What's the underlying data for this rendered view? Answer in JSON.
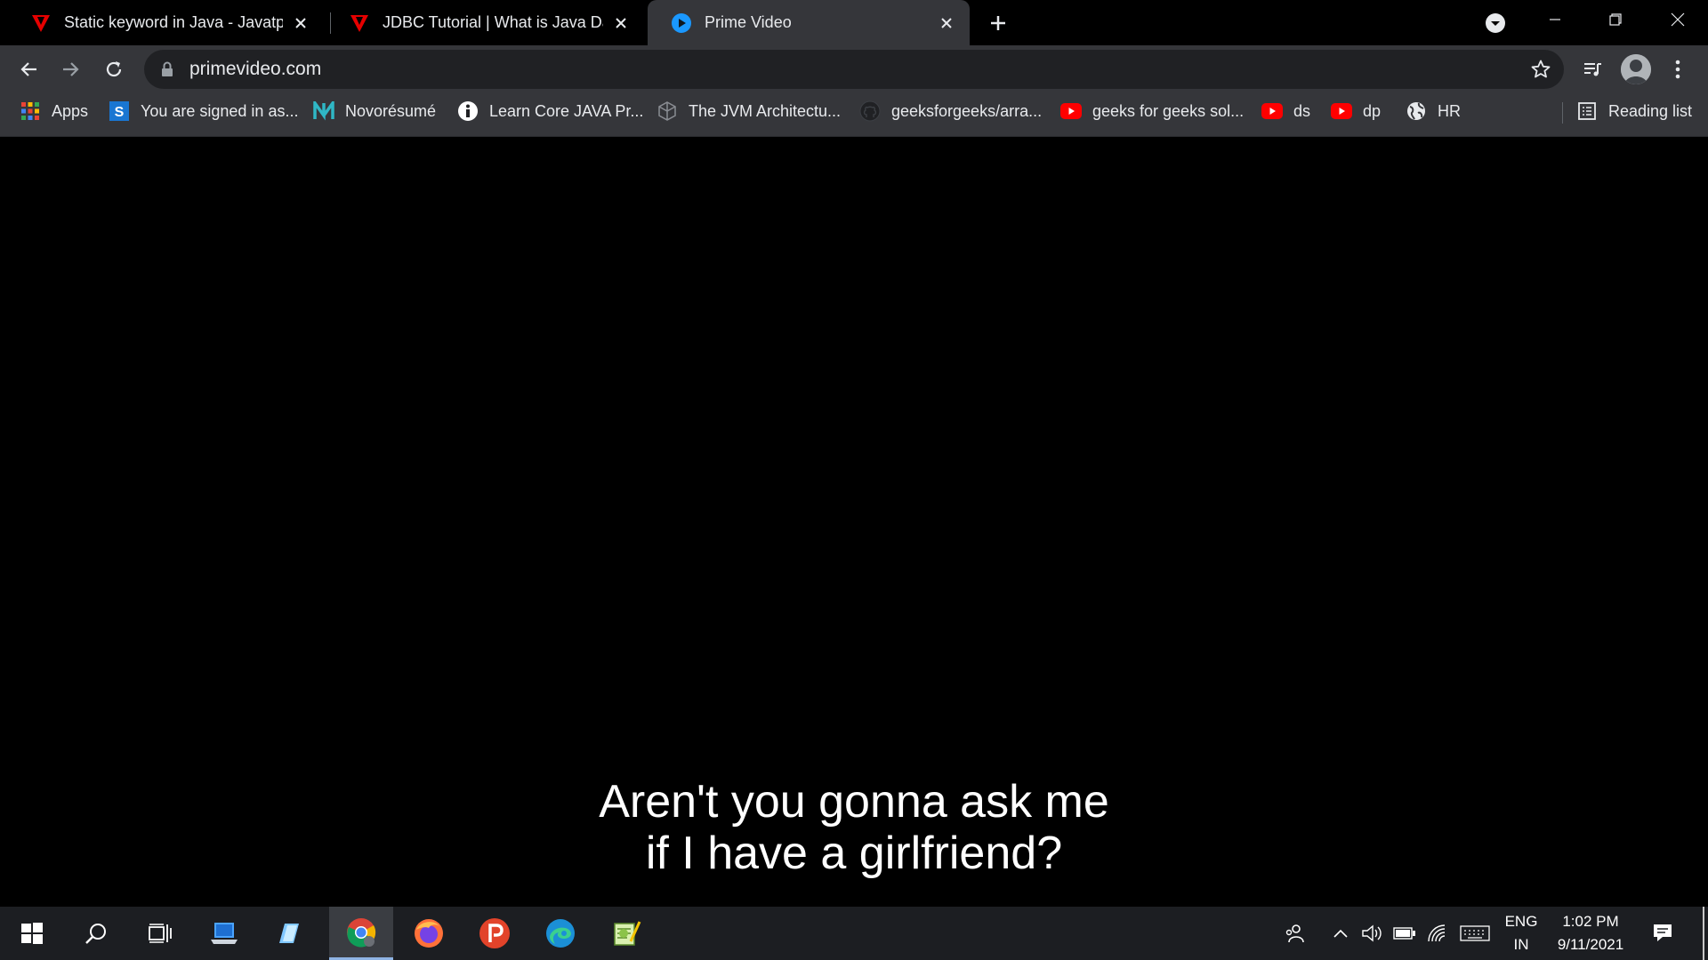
{
  "browser": {
    "tabs": [
      {
        "title": "Static keyword in Java - Javatpoint",
        "favicon": "javatpoint-favicon",
        "active": false
      },
      {
        "title": "JDBC Tutorial | What is Java Database Connectivity",
        "favicon": "javatpoint-favicon",
        "active": false
      },
      {
        "title": "Prime Video",
        "favicon": "primevideo-favicon",
        "active": true
      }
    ],
    "url": "primevideo.com",
    "bookmarks": [
      {
        "label": "Apps",
        "icon": "apps-grid-icon"
      },
      {
        "label": "You are signed in as...",
        "icon": "s-icon"
      },
      {
        "label": "Novorésumé",
        "icon": "novoresume-icon"
      },
      {
        "label": "Learn Core JAVA Pr...",
        "icon": "info-icon"
      },
      {
        "label": "The JVM Architectu...",
        "icon": "cube-icon"
      },
      {
        "label": "geeksforgeeks/arra...",
        "icon": "github-icon"
      },
      {
        "label": "geeks for geeks sol...",
        "icon": "youtube-icon"
      },
      {
        "label": "ds",
        "icon": "youtube-icon"
      },
      {
        "label": "dp",
        "icon": "youtube-icon"
      },
      {
        "label": "HR",
        "icon": "globe-icon"
      }
    ],
    "reading_list": "Reading list"
  },
  "video": {
    "subtitle_line1": "Aren't you gonna ask me",
    "subtitle_line2": "if I have a girlfriend?"
  },
  "taskbar": {
    "apps": [
      "start-icon",
      "search-icon",
      "task-view-icon",
      "this-pc-icon",
      "notepad-icon",
      "chrome-icon",
      "firefox-icon",
      "postman-icon",
      "edge-icon",
      "notepadpp-icon"
    ],
    "language_line1": "ENG",
    "language_line2": "IN",
    "time": "1:02 PM",
    "date": "9/11/2021"
  },
  "colors": {
    "tab_active_bg": "#35363a",
    "omnibox_bg": "#202124",
    "accent_red": "#e60000",
    "prime_blue": "#1a98ff"
  }
}
